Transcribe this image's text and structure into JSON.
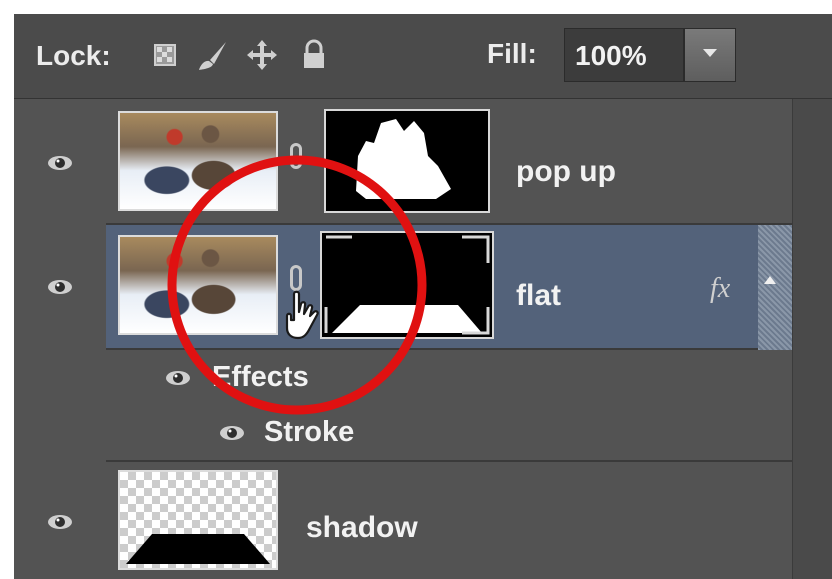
{
  "lock_bar": {
    "lock_label": "Lock:",
    "lock_icons": [
      "lock-transparent-pixels-icon",
      "lock-image-pixels-icon",
      "lock-position-icon",
      "lock-all-icon"
    ],
    "fill_label": "Fill:",
    "fill_value": "100%"
  },
  "layers": [
    {
      "name": "pop up",
      "has_mask": true,
      "visible": true
    },
    {
      "name": "flat",
      "has_mask": true,
      "visible": true,
      "selected": true,
      "fx": "fx"
    },
    {
      "name": "shadow",
      "has_mask": false,
      "visible": true
    }
  ],
  "effects": {
    "group_label": "Effects",
    "items": [
      {
        "name": "Stroke"
      }
    ]
  },
  "colors": {
    "panel_bg": "#535353",
    "selected_row": "#53627a",
    "annotation_circle": "#e01111"
  }
}
